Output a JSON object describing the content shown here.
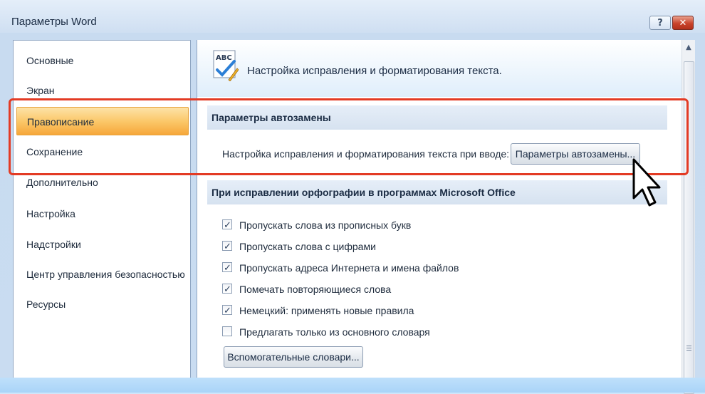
{
  "window": {
    "title": "Параметры Word",
    "help_label": "?",
    "close_label": "✕"
  },
  "sidebar": {
    "items": [
      {
        "label": "Основные"
      },
      {
        "label": "Экран"
      },
      {
        "label": "Правописание"
      },
      {
        "label": "Сохранение"
      },
      {
        "label": "Дополнительно"
      },
      {
        "label": "Настройка"
      },
      {
        "label": "Надстройки"
      },
      {
        "label": "Центр управления безопасностью"
      },
      {
        "label": "Ресурсы"
      }
    ],
    "selected_index": 2
  },
  "content": {
    "header_icon": "abc-spellcheck-icon",
    "header_text": "Настройка исправления и форматирования текста.",
    "autocorrect_section": {
      "title": "Параметры автозамены",
      "row_label": "Настройка исправления и форматирования текста при вводе:",
      "button_label": "Параметры автозамены..."
    },
    "spelling_section": {
      "title": "При исправлении орфографии в программах Microsoft Office",
      "checkboxes": [
        {
          "label": "Пропускать слова из прописных букв",
          "checked": true
        },
        {
          "label": "Пропускать слова с цифрами",
          "checked": true
        },
        {
          "label": "Пропускать адреса Интернета и имена файлов",
          "checked": true
        },
        {
          "label": "Помечать повторяющиеся слова",
          "checked": true
        },
        {
          "label": "Немецкий: применять новые правила",
          "checked": true
        },
        {
          "label": "Предлагать только из основного словаря",
          "checked": false
        }
      ],
      "dictionaries_button": "Вспомогательные словари..."
    }
  },
  "colors": {
    "highlight": "#e33b24",
    "selected_item": "#fbc86a"
  }
}
